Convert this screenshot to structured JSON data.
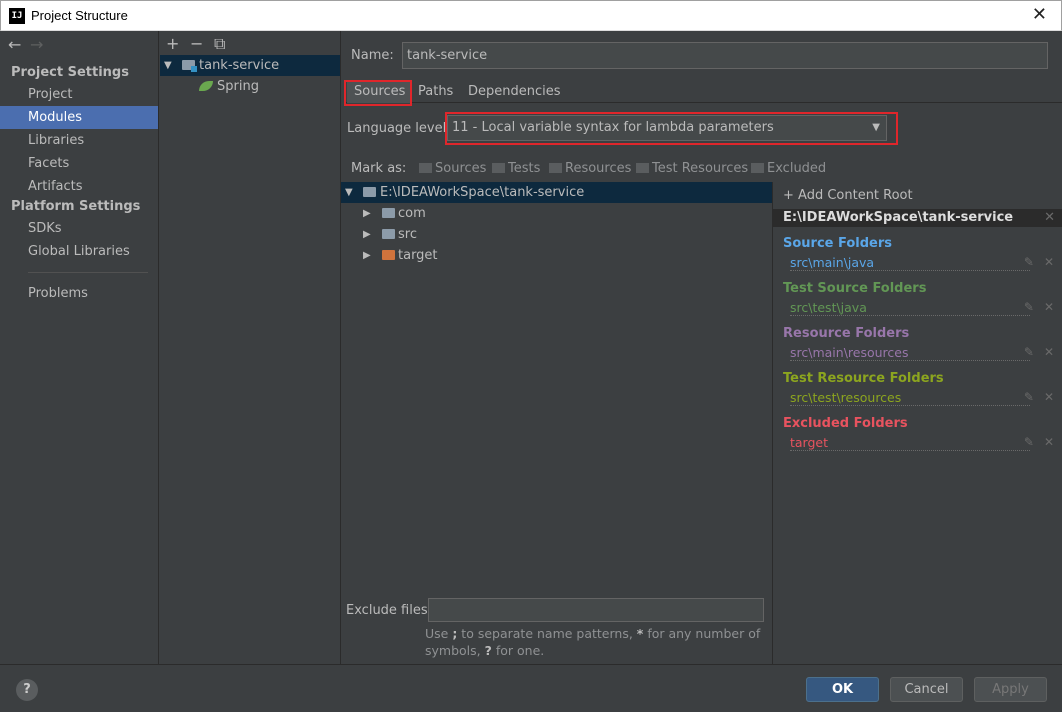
{
  "window": {
    "title": "Project Structure",
    "app_icon": "IJ",
    "close": "✕"
  },
  "nav": {
    "back": "←",
    "forward": "→",
    "project_settings": "Project Settings",
    "project_items": [
      "Project",
      "Modules",
      "Libraries",
      "Facets",
      "Artifacts"
    ],
    "platform_settings": "Platform Settings",
    "platform_items": [
      "SDKs",
      "Global Libraries"
    ],
    "problems": "Problems",
    "selected": "Modules"
  },
  "modules": {
    "toolbar": {
      "add": "+",
      "remove": "−",
      "copy": "⧉"
    },
    "tree": [
      {
        "label": "tank-service",
        "expanded": true
      },
      {
        "label": "Spring"
      }
    ]
  },
  "main": {
    "name_label": "Name:",
    "name_value": "tank-service",
    "tabs": [
      "Sources",
      "Paths",
      "Dependencies"
    ],
    "active_tab": "Sources",
    "language_label": "Language level:",
    "language_value": "11 - Local variable syntax for lambda parameters",
    "mark_as_label": "Mark as:",
    "mark_as": [
      "Sources",
      "Tests",
      "Resources",
      "Test Resources",
      "Excluded"
    ],
    "tree": [
      {
        "label": "E:\\IDEAWorkSpace\\tank-service",
        "expanded": true
      },
      {
        "label": "com"
      },
      {
        "label": "src"
      },
      {
        "label": "target"
      }
    ],
    "exclude_label": "Exclude files:",
    "exclude_value": "",
    "hint_prefix": "Use ",
    "hint_semicolon": ";",
    "hint_middle": " to separate name patterns, ",
    "hint_star": "*",
    "hint_middle2": " for any number of symbols, ",
    "hint_q": "?",
    "hint_suffix": " for one."
  },
  "content_root": {
    "add_label": "+ Add Content Root",
    "root_path": "E:\\IDEAWorkSpace\\tank-service",
    "groups": [
      {
        "title": "Source Folders",
        "path": "src\\main\\java",
        "color": "#5aa6e8"
      },
      {
        "title": "Test Source Folders",
        "path": "src\\test\\java",
        "color": "#629755"
      },
      {
        "title": "Resource Folders",
        "path": "src\\main\\resources",
        "color": "#9876aa"
      },
      {
        "title": "Test Resource Folders",
        "path": "src\\test\\resources",
        "color": "#8ca51f"
      },
      {
        "title": "Excluded Folders",
        "path": "target",
        "color": "#e8535f"
      }
    ]
  },
  "buttons": {
    "help": "?",
    "ok": "OK",
    "cancel": "Cancel",
    "apply": "Apply"
  }
}
